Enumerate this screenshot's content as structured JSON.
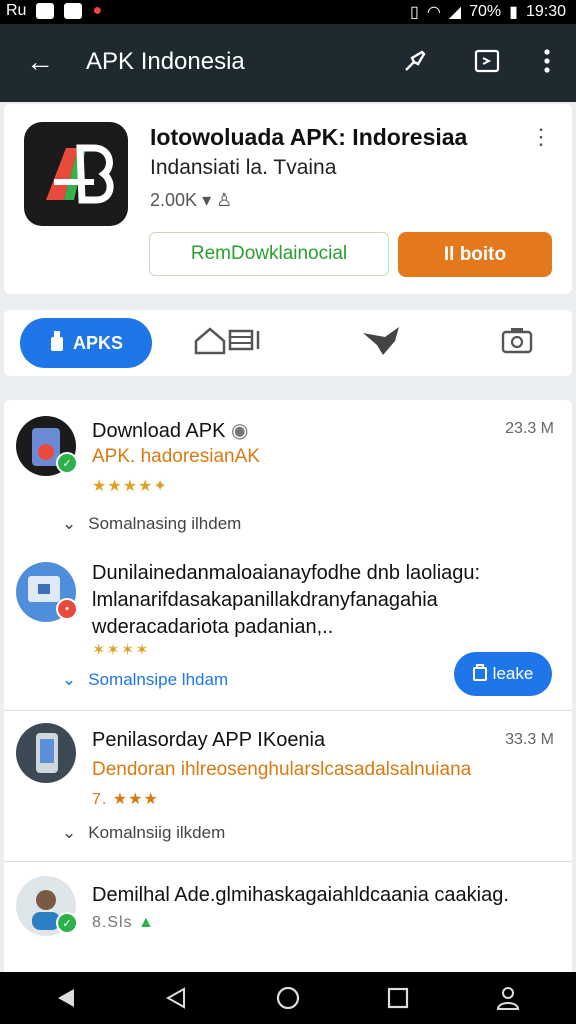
{
  "status": {
    "left_text": "Ru",
    "battery": "70%",
    "time": "19:30"
  },
  "appbar": {
    "back_glyph": "←",
    "title": "APK Indonesia"
  },
  "hero": {
    "app_name": "Iotowoluada APK: Indoresiaa",
    "subtitle": "Indansiati la. Tvaina",
    "meta": "2.00K",
    "more": "⋮",
    "button_outline": "RemDowklainocial",
    "button_primary": "Il boito"
  },
  "tabs": {
    "active_label": "APKS"
  },
  "items": [
    {
      "title": "Download APK",
      "size": "23.3 M",
      "subtitle": "APK. hadoresianAK",
      "stars": "★★★★✦",
      "expand": "Somalnasing ilhdem"
    },
    {
      "title_lines": [
        "Dunilainedanmaloaianayfodhe dnb laoliagu:",
        "lmlanarifdasakapanillakdranyfanagahia",
        "wderacadariota padanian,.."
      ],
      "stars": "✶✶✶✶",
      "expand": "Somalnsipe lhdam",
      "button": "leake"
    },
    {
      "title": "Penilasorday APP IKoenia",
      "size": "33.3 M",
      "subtitle": "Dendoran ihlreosenghularslcasadalsalnuiana",
      "rating": "7. ★★★",
      "expand": "Komalnsiig ilkdem"
    },
    {
      "title": "Demilhal Ade.glmihaskagaiahldcaania caakiag.",
      "rating": "8.Sls"
    }
  ],
  "colors": {
    "appbar": "#1f2a30",
    "accent_blue": "#1e76e8",
    "accent_orange": "#e3781d",
    "green": "#27a02e"
  }
}
